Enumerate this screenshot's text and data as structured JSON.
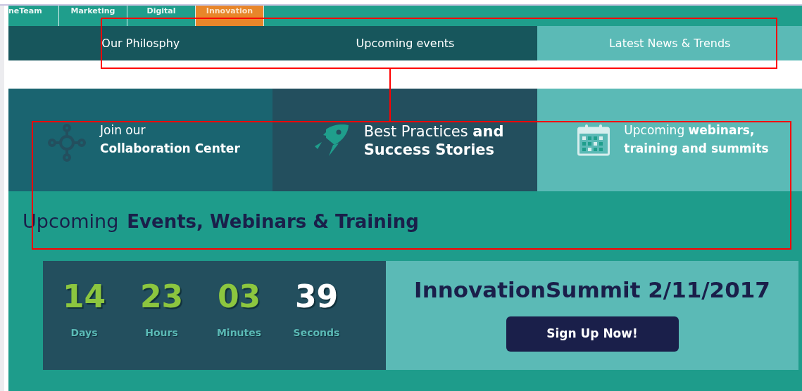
{
  "top_tabs": [
    {
      "label": "neTeam",
      "selected": false
    },
    {
      "label": "Marketing",
      "selected": false
    },
    {
      "label": "Digital",
      "selected": false
    },
    {
      "label": "Innovation",
      "selected": true
    }
  ],
  "sub_nav": [
    {
      "label": "Our Philosphy",
      "selected": false
    },
    {
      "label": "Upcoming events",
      "selected": false
    },
    {
      "label": "Latest News & Trends",
      "selected": true
    }
  ],
  "features": [
    {
      "kind": "network",
      "lines": [
        "Join our",
        "**Collaboration Center**"
      ]
    },
    {
      "kind": "rocket",
      "lines": [
        "Best Practices **and**",
        "**Success Stories**"
      ]
    },
    {
      "kind": "calendar",
      "lines": [
        "Upcoming **webinars,**",
        "**training and summits**"
      ]
    }
  ],
  "heading": {
    "light": "Upcoming",
    "bold": "Events, Webinars & Training"
  },
  "countdown": [
    {
      "value": "14",
      "unit": "Days",
      "highlight": true
    },
    {
      "value": "23",
      "unit": "Hours",
      "highlight": true
    },
    {
      "value": "03",
      "unit": "Minutes",
      "highlight": true
    },
    {
      "value": "39",
      "unit": "Seconds",
      "highlight": false
    }
  ],
  "event": {
    "title": "InnovationSummit 2/11/2017",
    "button": "Sign Up Now!"
  }
}
